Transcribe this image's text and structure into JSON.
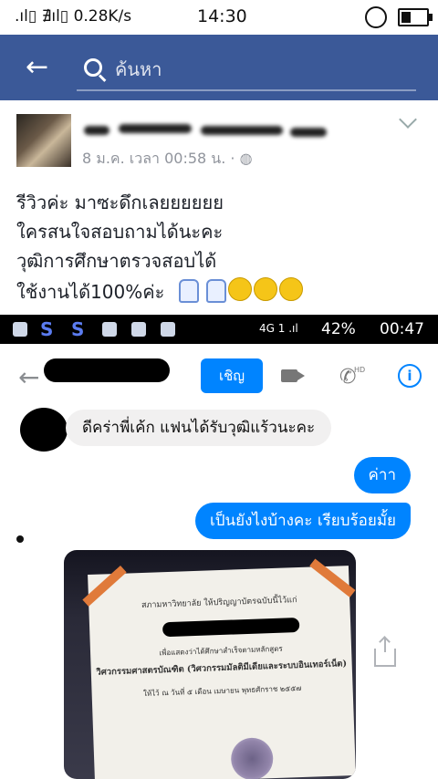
{
  "status_bar": {
    "network_speed": "0.28K/s",
    "time": "14:30"
  },
  "fb_header": {
    "search_placeholder": "ค้นหา"
  },
  "post": {
    "time": "8 ม.ค. เวลา 00:58 น. · ",
    "lines": [
      "รีวิวค่ะ มาซะดึกเลยยยยยย",
      "ใครสนใจสอบถามได้นะคะ",
      "วุฒิการศึกษาตรวจสอบได้",
      "ใช้งานได้100%ค่ะ"
    ]
  },
  "chat_screenshot": {
    "status_bar": {
      "network": "4G",
      "sim": "1",
      "battery": "42%",
      "time": "00:47"
    },
    "header": {
      "invite_label": "เชิญ",
      "hd_label": "HD"
    },
    "messages": [
      {
        "from": "contact",
        "text": "ดีคร่าพี่เค้ก แฟนได้รับวุฒิแร้วนะคะ"
      },
      {
        "from": "me",
        "text": "ค่าา"
      },
      {
        "from": "me",
        "text": "เป็นยังไงบ้างคะ เรียบร้อยมั้ย"
      }
    ],
    "certificate": {
      "line1": "สภามหาวิทยาลัย ให้ปริญญาบัตรฉบับนี้ไว้แก่",
      "line2": "เพื่อแสดงว่าได้ศึกษาสำเร็จตามหลักสูตร",
      "degree": "วิศวกรรมศาสตรบัณฑิต (วิศวกรรมมัลติมีเดียและระบบอินเทอร์เน็ต)",
      "line4": "ให้ไว้ ณ วันที่ ๕ เดือน เมษายน พุทธศักราช ๒๕๕๗"
    }
  }
}
